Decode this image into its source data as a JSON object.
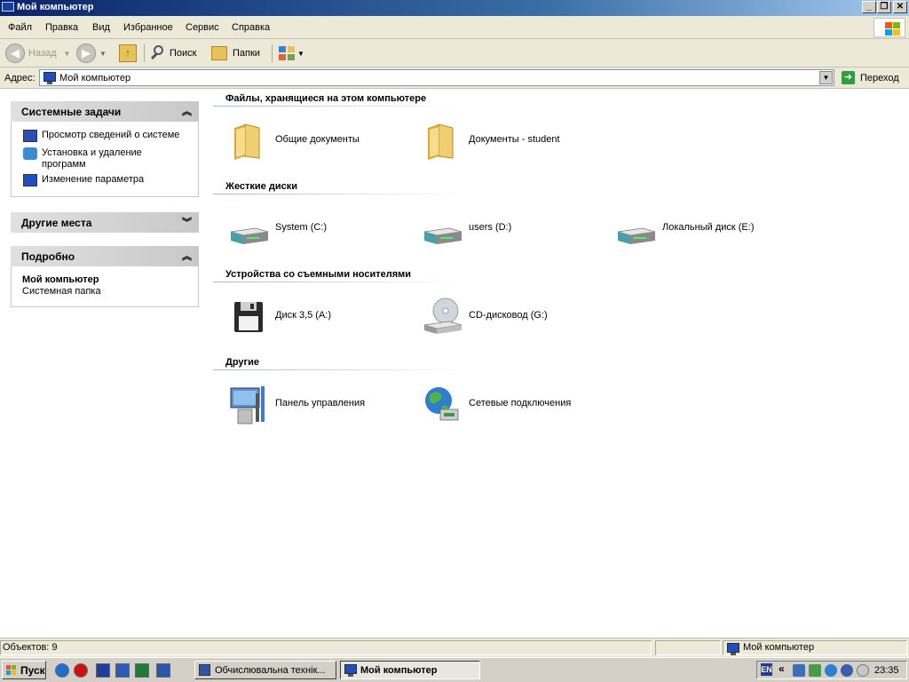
{
  "window": {
    "title": "Мой компьютер"
  },
  "menu": [
    "Файл",
    "Правка",
    "Вид",
    "Избранное",
    "Сервис",
    "Справка"
  ],
  "toolbar": {
    "back_label": "Назад",
    "search_label": "Поиск",
    "folders_label": "Папки"
  },
  "address": {
    "label": "Адрес:",
    "value": "Мой компьютер",
    "go_label": "Переход"
  },
  "left_panel": {
    "system_tasks": {
      "title": "Системные задачи",
      "items": [
        "Просмотр сведений о системе",
        "Установка и удаление программ",
        "Изменение параметра"
      ]
    },
    "other_places": {
      "title": "Другие места"
    },
    "details": {
      "title": "Подробно",
      "name": "Мой компьютер",
      "type": "Системная папка"
    }
  },
  "groups": [
    {
      "title": "Файлы, хранящиеся на этом компьютере",
      "items": [
        "Общие документы",
        "Документы - student"
      ]
    },
    {
      "title": "Жесткие диски",
      "items": [
        "System (C:)",
        "users (D:)",
        "Локальный диск (E:)"
      ]
    },
    {
      "title": "Устройства со съемными носителями",
      "items": [
        "Диск 3,5 (A:)",
        "CD-дисковод (G:)"
      ]
    },
    {
      "title": "Другие",
      "items": [
        "Панель управления",
        "Сетевые подключения"
      ]
    }
  ],
  "status": {
    "objects": "Объектов: 9",
    "location": "Мой компьютер"
  },
  "taskbar": {
    "start_label": "Пуск",
    "windows": [
      "Обчислювальна технік...",
      "Мой компьютер"
    ],
    "language": "EN",
    "time": "23:35"
  },
  "colors": {
    "titlebar": "#0a246a",
    "folder": "#e8c15a",
    "group_header_line": "#a9b8d8"
  }
}
